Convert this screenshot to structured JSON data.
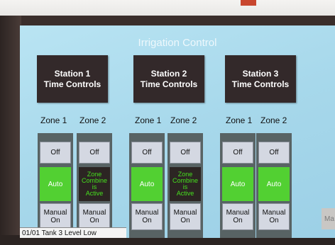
{
  "screen": {
    "title": "Irrigation Control"
  },
  "stations": [
    {
      "label": "Station 1\nTime Controls"
    },
    {
      "label": "Station 2\nTime Controls"
    },
    {
      "label": "Station 3\nTime Controls"
    }
  ],
  "zones": [
    {
      "label": "Zone 1",
      "off": "Off",
      "mode": "Auto",
      "manual": "Manual\nOn"
    },
    {
      "label": "Zone 2",
      "off": "Off",
      "mode": "Zone\nCombine\nis\nActive",
      "manual": "Manual\nOn"
    },
    {
      "label": "Zone 1",
      "off": "Off",
      "mode": "Auto",
      "manual": "Manual\nOn"
    },
    {
      "label": "Zone 2",
      "off": "Off",
      "mode": "Zone\nCombine\nis\nActive",
      "manual": "Manual\nOn"
    },
    {
      "label": "Zone 1",
      "off": "Off",
      "mode": "Auto",
      "manual": "Manual\nOn"
    },
    {
      "label": "Zone 2",
      "off": "Off",
      "mode": "Auto",
      "manual": "Manual\nOn"
    }
  ],
  "partial_button": {
    "label": "Ma"
  },
  "status_bar": {
    "message": "01/01 Tank 3 Level Low"
  },
  "colors": {
    "auto_active": "#52d032",
    "combine_text": "#46e01e",
    "screen_bg": "#a7d8eb",
    "button_dark": "#33292a"
  }
}
